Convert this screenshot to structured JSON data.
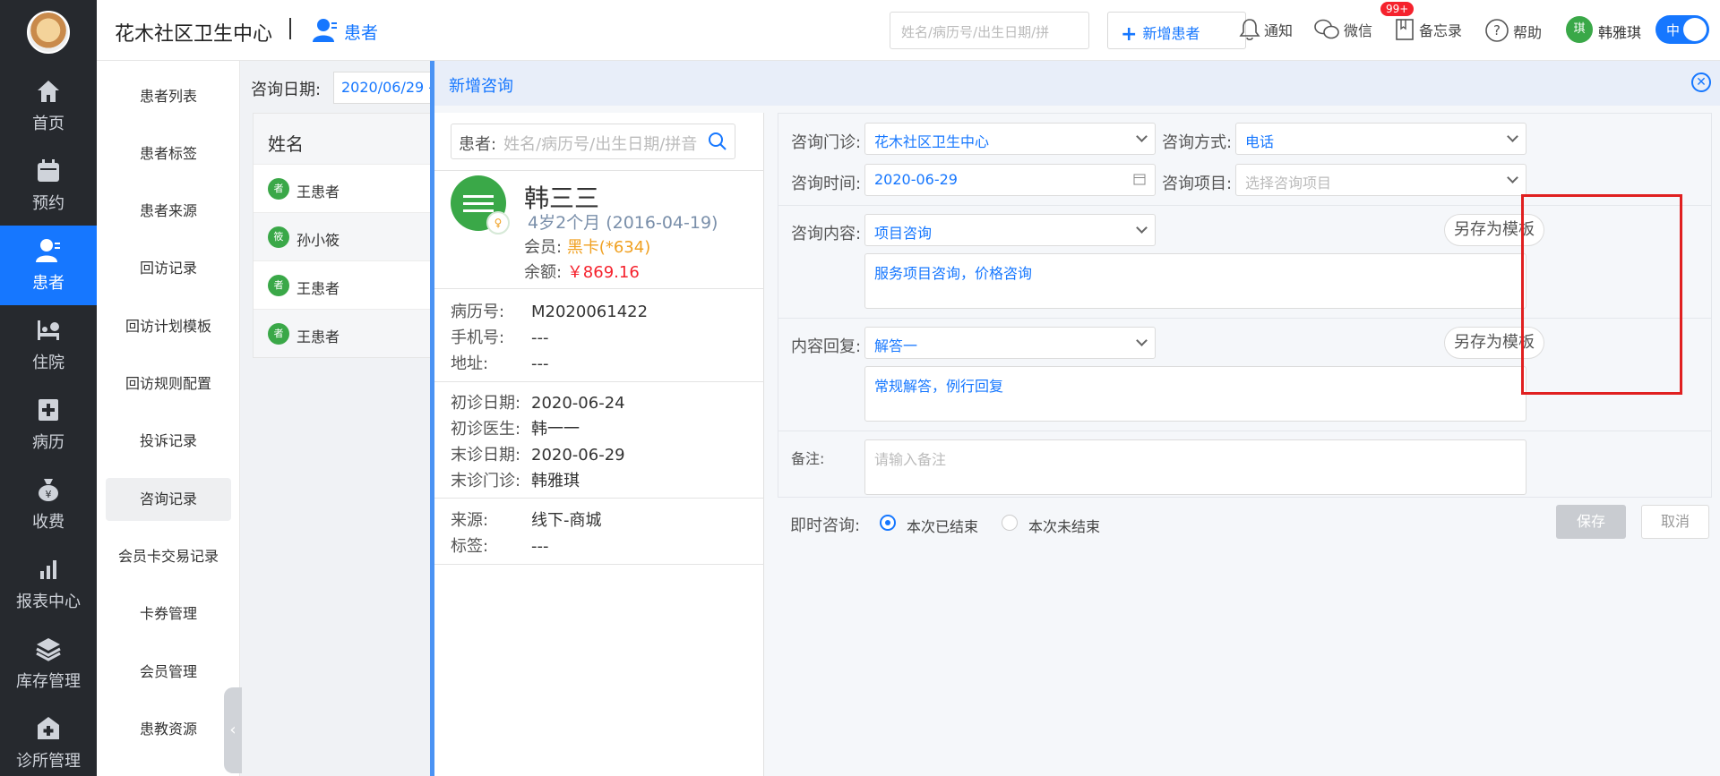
{
  "nav": {
    "items": [
      {
        "label": "首页",
        "icon": "home-icon"
      },
      {
        "label": "预约",
        "icon": "calendar-icon"
      },
      {
        "label": "患者",
        "icon": "patient-icon",
        "active": true
      },
      {
        "label": "住院",
        "icon": "bed-icon"
      },
      {
        "label": "病历",
        "icon": "medical-record-icon"
      },
      {
        "label": "收费",
        "icon": "money-bag-icon"
      },
      {
        "label": "报表中心",
        "icon": "bar-chart-icon"
      },
      {
        "label": "库存管理",
        "icon": "layers-icon"
      },
      {
        "label": "诊所管理",
        "icon": "clinic-icon"
      }
    ]
  },
  "header": {
    "clinic_name": "花木社区卫生中心",
    "section": "患者",
    "search_placeholder": "姓名/病历号/出生日期/拼",
    "add_patient": "新增患者",
    "notify": "通知",
    "notify_badge": "99+",
    "wechat": "微信",
    "memo": "备忘录",
    "help": "帮助",
    "user_avatar": "琪",
    "user_name": "韩雅琪",
    "lang": "中"
  },
  "subnav": {
    "items": [
      "患者列表",
      "患者标签",
      "患者来源",
      "回访记录",
      "回访计划模板",
      "回访规则配置",
      "投诉记录",
      "咨询记录",
      "会员卡交易记录",
      "卡券管理",
      "会员管理",
      "患教资源"
    ],
    "active_index": 7
  },
  "background": {
    "date_label": "咨询日期:",
    "date_value": "2020/06/29 -",
    "column_name": "姓名",
    "rows": [
      {
        "badge": "者",
        "name": "王患者"
      },
      {
        "badge": "筱",
        "name": "孙小筱"
      },
      {
        "badge": "者",
        "name": "王患者"
      },
      {
        "badge": "者",
        "name": "王患者"
      }
    ]
  },
  "drawer": {
    "title": "新增咨询",
    "patient_search_label": "患者:",
    "patient_search_placeholder": "姓名/病历号/出生日期/拼音",
    "patient": {
      "name": "韩三三",
      "age": "4岁2个月 (2016-04-19)",
      "member_label": "会员:",
      "member_value": "黑卡(*634)",
      "balance_label": "余额:",
      "balance_value": "￥869.16",
      "record_no_label": "病历号:",
      "record_no": "M2020061422",
      "phone_label": "手机号:",
      "phone": "---",
      "address_label": "地址:",
      "address": "---",
      "first_visit_label": "初诊日期:",
      "first_visit": "2020-06-24",
      "first_doctor_label": "初诊医生:",
      "first_doctor": "韩一一",
      "last_visit_label": "末诊日期:",
      "last_visit": "2020-06-29",
      "last_clinic_label": "末诊门诊:",
      "last_clinic": "韩雅琪",
      "source_label": "来源:",
      "source": "线下-商城",
      "tags_label": "标签:",
      "tags": "---"
    },
    "form": {
      "clinic_label": "咨询门诊:",
      "clinic_value": "花木社区卫生中心",
      "method_label": "咨询方式:",
      "method_value": "电话",
      "time_label": "咨询时间:",
      "time_value": "2020-06-29",
      "item_label": "咨询项目:",
      "item_placeholder": "选择咨询项目",
      "content_label": "咨询内容:",
      "content_select": "项目咨询",
      "content_text": "服务项目咨询，价格咨询",
      "reply_label": "内容回复:",
      "reply_select": "解答一",
      "reply_text": "常规解答，例行回复",
      "save_template": "另存为模板",
      "note_label": "备注:",
      "note_placeholder": "请输入备注",
      "instant_label": "即时咨询:",
      "option_ended": "本次已结束",
      "option_not_ended": "本次未结束",
      "selected_option": "本次已结束",
      "save": "保存",
      "cancel": "取消"
    }
  },
  "colors": {
    "nav_bg": "#26292e",
    "accent": "#1677ff",
    "highlight_box": "#e02020",
    "balance": "#f5222d",
    "member": "#f0a020"
  }
}
